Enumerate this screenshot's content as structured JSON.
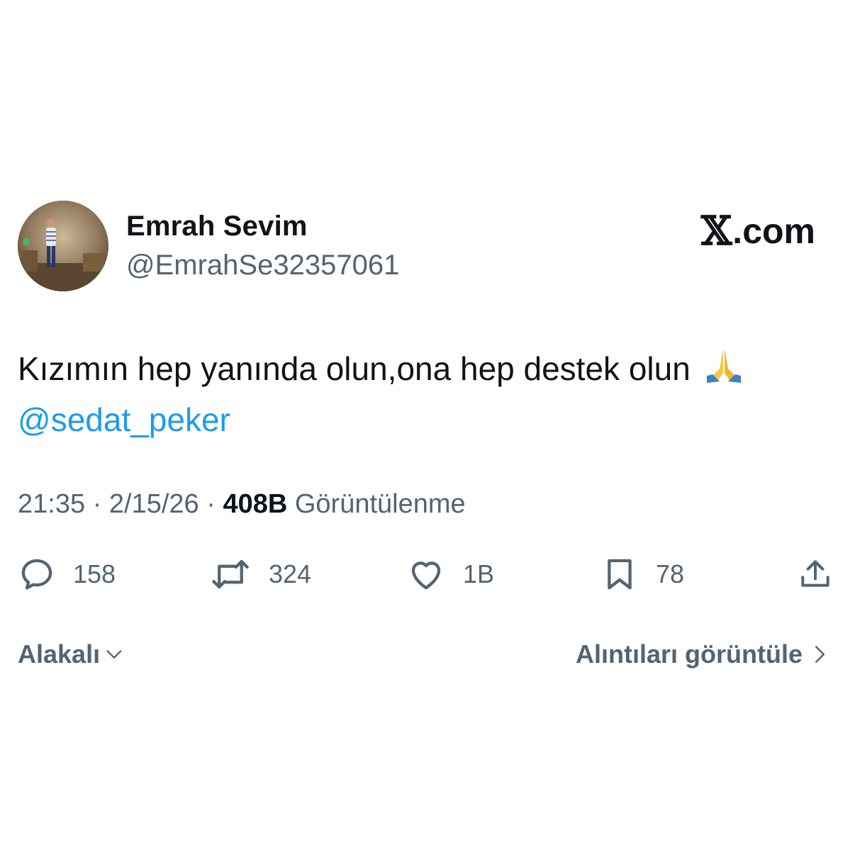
{
  "author": {
    "display_name": "Emrah Sevim",
    "handle": "@EmrahSe32357061"
  },
  "brand": {
    "x_glyph": "𝕏",
    "domain": ".com"
  },
  "tweet": {
    "text_line1": "Kızımın hep yanında olun,ona hep destek olun",
    "mention": "@sedat_peker",
    "emoji": "pray-emoji"
  },
  "meta": {
    "time": "21:35",
    "sep1": " · ",
    "date": "2/15/26",
    "sep2": " · ",
    "views_count": "408B",
    "views_label": " Görüntülenme"
  },
  "actions": {
    "replies": "158",
    "reposts": "324",
    "likes": "1B",
    "bookmarks": "78"
  },
  "footer": {
    "sort_label": "Alakalı",
    "quotes_label": "Alıntıları görüntüle"
  },
  "colors": {
    "text_primary": "#0f1419",
    "text_secondary": "#536471",
    "link": "#1d9bf0"
  }
}
